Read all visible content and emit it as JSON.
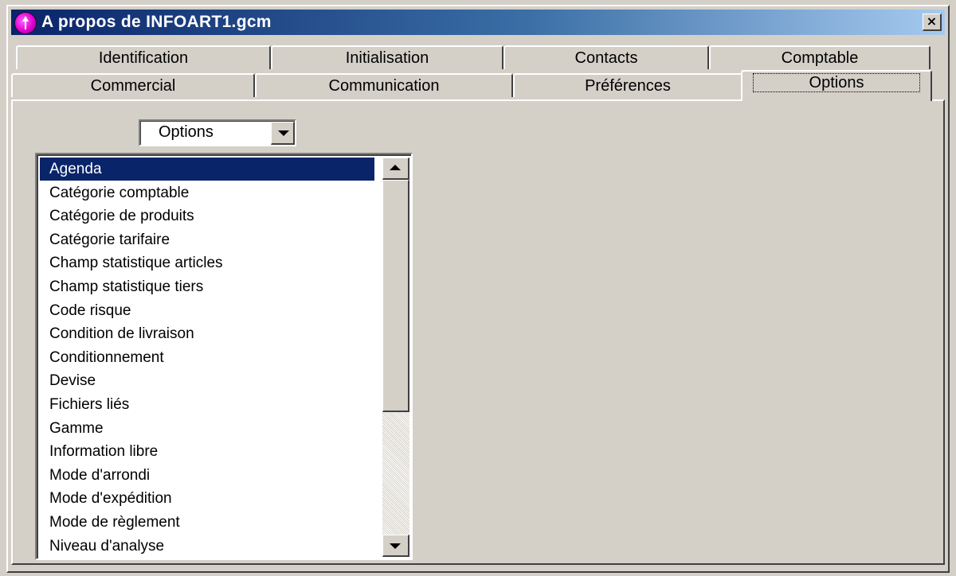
{
  "window": {
    "title": "A propos de INFOART1.gcm",
    "close_label": "×",
    "icon": "app-magenta-arrow-icon",
    "colors": {
      "titlebar_start": "#0a246a",
      "titlebar_end": "#a6caf0",
      "face": "#d4d0c8",
      "selection": "#0a246a"
    }
  },
  "tabs": {
    "row1": [
      "Identification",
      "Initialisation",
      "Contacts",
      "Comptable"
    ],
    "row2": [
      "Commercial",
      "Communication",
      "Préférences",
      "Options"
    ],
    "active": "Options"
  },
  "combo": {
    "value": "Options"
  },
  "list": {
    "items": [
      "Agenda",
      "Catégorie comptable",
      "Catégorie de produits",
      "Catégorie tarifaire",
      "Champ statistique articles",
      "Champ statistique tiers",
      "Code risque",
      "Condition de livraison",
      "Conditionnement",
      "Devise",
      "Fichiers liés",
      "Gamme",
      "Information libre",
      "Mode d'arrondi",
      "Mode d'expédition",
      "Mode de règlement",
      "Niveau d'analyse"
    ],
    "selected_index": 0
  }
}
